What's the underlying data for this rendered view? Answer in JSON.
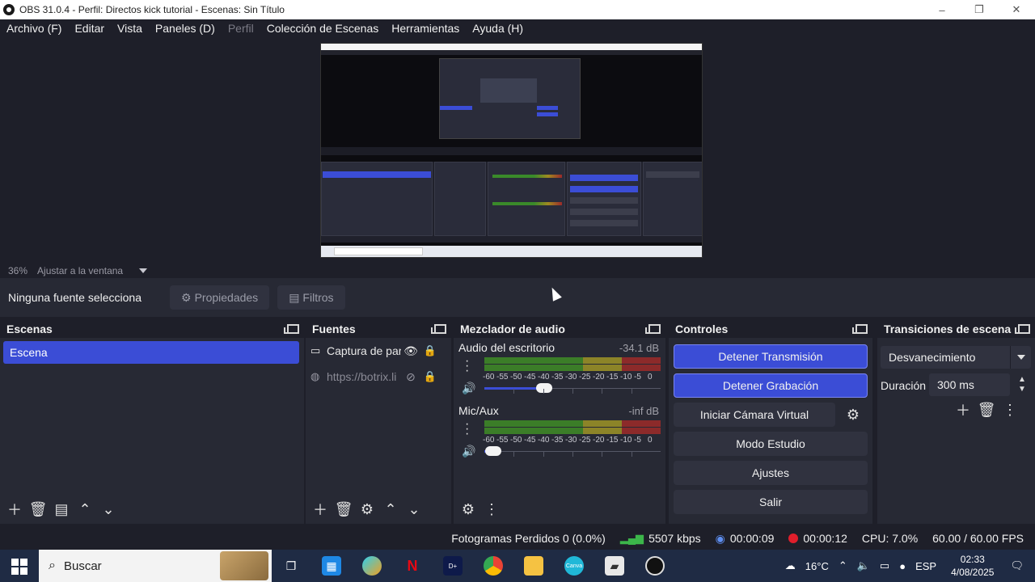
{
  "window": {
    "title": "OBS 31.0.4 - Perfil: Directos kick tutorial - Escenas: Sin Título",
    "controls": [
      "–",
      "❐",
      "✕"
    ]
  },
  "menu": [
    {
      "label": "Archivo (F)",
      "enabled": true
    },
    {
      "label": "Editar",
      "enabled": true
    },
    {
      "label": "Vista",
      "enabled": true
    },
    {
      "label": "Paneles (D)",
      "enabled": true
    },
    {
      "label": "Perfil",
      "enabled": false
    },
    {
      "label": "Colección de Escenas",
      "enabled": true
    },
    {
      "label": "Herramientas",
      "enabled": true
    },
    {
      "label": "Ayuda (H)",
      "enabled": true
    }
  ],
  "preview": {
    "zoom": "36%",
    "fit_label": "Ajustar a la ventana"
  },
  "context": {
    "no_source": "Ninguna fuente selecciona",
    "properties_label": "Propiedades",
    "filters_label": "Filtros"
  },
  "scenes": {
    "title": "Escenas",
    "items": [
      "Escena"
    ]
  },
  "sources": {
    "title": "Fuentes",
    "items": [
      {
        "name": "Captura de par",
        "visible": true,
        "locked": true
      },
      {
        "name": "https://botrix.li",
        "visible": false,
        "locked": true
      }
    ]
  },
  "mixer": {
    "title": "Mezclador de audio",
    "channels": [
      {
        "name": "Audio del escritorio",
        "db": "-34.1 dB",
        "volume_percent": 34
      },
      {
        "name": "Mic/Aux",
        "db": "-inf dB",
        "volume_percent": 5
      }
    ],
    "scale": [
      "-60",
      "-55",
      "-50",
      "-45",
      "-40",
      "-35",
      "-30",
      "-25",
      "-20",
      "-15",
      "-10",
      "-5",
      "0"
    ]
  },
  "controls": {
    "title": "Controles",
    "stop_stream": "Detener Transmisión",
    "stop_record": "Detener Grabación",
    "virtual_cam": "Iniciar Cámara Virtual",
    "studio_mode": "Modo Estudio",
    "settings": "Ajustes",
    "exit": "Salir"
  },
  "transitions": {
    "title": "Transiciones de escena",
    "selected": "Desvanecimiento",
    "duration_label": "Duración",
    "duration_value": "300 ms"
  },
  "status": {
    "dropped": "Fotogramas Perdidos 0 (0.0%)",
    "bitrate": "5507 kbps",
    "stream_time": "00:00:09",
    "rec_time": "00:00:12",
    "cpu": "CPU: 7.0%",
    "fps": "60.00 / 60.00 FPS"
  },
  "taskbar": {
    "search_placeholder": "Buscar",
    "weather": "16°C",
    "language": "ESP",
    "time": "02:33",
    "date": "4/08/2025"
  },
  "colors": {
    "accent": "#3b4dd6",
    "background": "#1e1f29",
    "panel": "#272934",
    "recording": "#e01e2b",
    "signal": "#3cb64a"
  }
}
